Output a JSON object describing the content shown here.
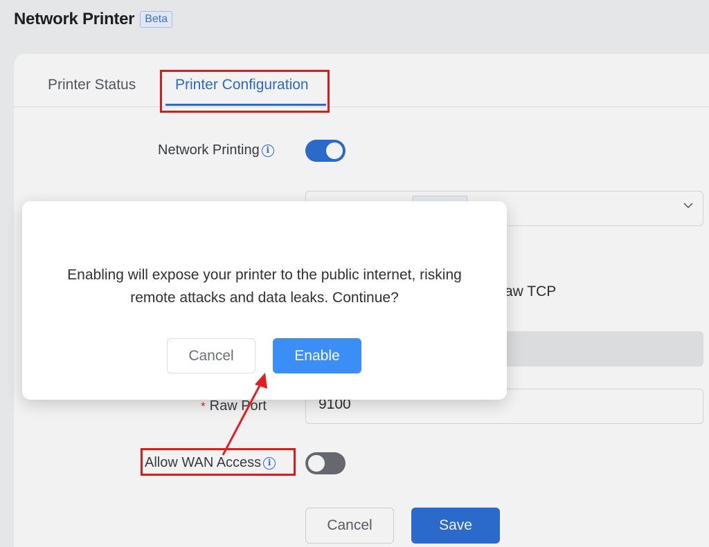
{
  "header": {
    "title": "Network Printer",
    "badge": "Beta"
  },
  "tabs": [
    {
      "label": "Printer Status",
      "active": false
    },
    {
      "label": "Printer Configuration",
      "active": true
    }
  ],
  "form": {
    "network_printing_label": "Network Printing",
    "network_printing_enabled": true,
    "protocol_partial_text": "aw TCP",
    "raw_port_label": "Raw Port",
    "raw_port_value": "9100",
    "allow_wan_label": "Allow WAN Access",
    "allow_wan_enabled": false,
    "cancel_label": "Cancel",
    "save_label": "Save"
  },
  "modal": {
    "message": "Enabling will expose your printer to the public internet, risking remote attacks and data leaks. Continue?",
    "cancel_label": "Cancel",
    "enable_label": "Enable"
  },
  "icons": {
    "info": "info-icon",
    "chevron": "chevron-down-icon"
  },
  "colors": {
    "accent": "#2e6fd6",
    "enable_button": "#3a8ef5",
    "annotation": "#e02020"
  }
}
